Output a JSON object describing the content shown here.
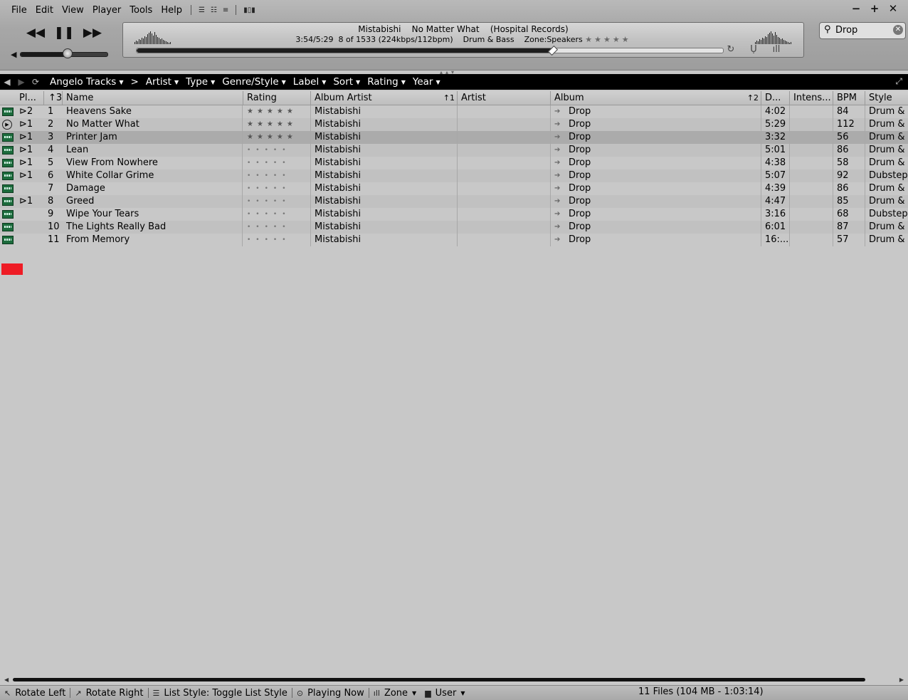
{
  "menu": [
    "File",
    "Edit",
    "View",
    "Player",
    "Tools",
    "Help"
  ],
  "window_controls": {
    "minimize": "−",
    "maximize": "+",
    "close": "✕"
  },
  "player": {
    "artist": "Mistabishi",
    "title": "No Matter What",
    "label": "(Hospital Records)",
    "time": "3:54/5:29",
    "position": "8 of 1533",
    "bitrate": "(224kbps/112bpm)",
    "genre": "Drum & Bass",
    "zone": "Zone:Speakers",
    "stars": "★★★★★",
    "progress": 0.71,
    "volume": 0.55
  },
  "search": {
    "value": "Drop",
    "placeholder": ""
  },
  "nav": {
    "root": "Angelo Tracks",
    "separator": ">",
    "items": [
      "Artist",
      "Type",
      "Genre/Style",
      "Label",
      "Sort",
      "Rating",
      "Year"
    ]
  },
  "columns": {
    "playlist": "Pl...",
    "num_sort": "↑3",
    "name": "Name",
    "rating": "Rating",
    "album_artist": "Album Artist",
    "album_artist_sort": "↑1",
    "artist": "Artist",
    "album": "Album",
    "album_sort": "↑2",
    "duration": "D...",
    "intensity": "Intens...",
    "bpm": "BPM",
    "style": "Style"
  },
  "tracks": [
    {
      "icon": "file",
      "pl": "⊳2",
      "num": "1",
      "name": "Heavens Sake",
      "rating": "★★★★★",
      "rated": true,
      "album_artist": "Mistabishi",
      "artist": "",
      "album": "Drop",
      "duration": "4:02",
      "intensity": "",
      "bpm": "84",
      "style": "Drum & Bass"
    },
    {
      "icon": "playing",
      "pl": "⊳1",
      "num": "2",
      "name": "No Matter What",
      "rating": "★★★★★",
      "rated": true,
      "album_artist": "Mistabishi",
      "artist": "",
      "album": "Drop",
      "duration": "5:29",
      "intensity": "",
      "bpm": "112",
      "style": "Drum & Bass"
    },
    {
      "icon": "file",
      "pl": "⊳1",
      "num": "3",
      "name": "Printer Jam",
      "rating": "★★★★★",
      "rated": true,
      "album_artist": "Mistabishi",
      "artist": "",
      "album": "Drop",
      "duration": "3:32",
      "intensity": "",
      "bpm": "56",
      "style": "Drum & Bass",
      "selected": true
    },
    {
      "icon": "file",
      "pl": "⊳1",
      "num": "4",
      "name": "Lean",
      "rating": "•••••",
      "rated": false,
      "album_artist": "Mistabishi",
      "artist": "",
      "album": "Drop",
      "duration": "5:01",
      "intensity": "",
      "bpm": "86",
      "style": "Drum & Bass"
    },
    {
      "icon": "file",
      "pl": "⊳1",
      "num": "5",
      "name": "View From Nowhere",
      "rating": "•••••",
      "rated": false,
      "album_artist": "Mistabishi",
      "artist": "",
      "album": "Drop",
      "duration": "4:38",
      "intensity": "",
      "bpm": "58",
      "style": "Drum & Bass"
    },
    {
      "icon": "file",
      "pl": "⊳1",
      "num": "6",
      "name": "White Collar Grime",
      "rating": "•••••",
      "rated": false,
      "album_artist": "Mistabishi",
      "artist": "",
      "album": "Drop",
      "duration": "5:07",
      "intensity": "",
      "bpm": "92",
      "style": "Dubstep"
    },
    {
      "icon": "file",
      "pl": "",
      "num": "7",
      "name": "Damage",
      "rating": "•••••",
      "rated": false,
      "album_artist": "Mistabishi",
      "artist": "",
      "album": "Drop",
      "duration": "4:39",
      "intensity": "",
      "bpm": "86",
      "style": "Drum & Bass"
    },
    {
      "icon": "file",
      "pl": "⊳1",
      "num": "8",
      "name": "Greed",
      "rating": "•••••",
      "rated": false,
      "album_artist": "Mistabishi",
      "artist": "",
      "album": "Drop",
      "duration": "4:47",
      "intensity": "",
      "bpm": "85",
      "style": "Drum & Bass"
    },
    {
      "icon": "file",
      "pl": "",
      "num": "9",
      "name": "Wipe Your Tears",
      "rating": "•••••",
      "rated": false,
      "album_artist": "Mistabishi",
      "artist": "",
      "album": "Drop",
      "duration": "3:16",
      "intensity": "",
      "bpm": "68",
      "style": "Dubstep"
    },
    {
      "icon": "file",
      "pl": "",
      "num": "10",
      "name": "The Lights Really Bad",
      "rating": "•••••",
      "rated": false,
      "album_artist": "Mistabishi",
      "artist": "",
      "album": "Drop",
      "duration": "6:01",
      "intensity": "",
      "bpm": "87",
      "style": "Drum & Bass"
    },
    {
      "icon": "file",
      "pl": "",
      "num": "11",
      "name": "From Memory",
      "rating": "•••••",
      "rated": false,
      "album_artist": "Mistabishi",
      "artist": "",
      "album": "Drop",
      "duration": "16:...",
      "intensity": "",
      "bpm": "57",
      "style": "Drum & Bass"
    }
  ],
  "statusbar": {
    "rotate_left": "Rotate Left",
    "rotate_right": "Rotate Right",
    "list_style": "List Style: Toggle List Style",
    "playing_now": "Playing Now",
    "zone": "Zone",
    "user": "User",
    "files": "11 Files (104 MB - 1:03:14)"
  },
  "colors": {
    "marker": "#ee1c25",
    "header_bar": "#000000",
    "background": "#c8c8c8"
  }
}
